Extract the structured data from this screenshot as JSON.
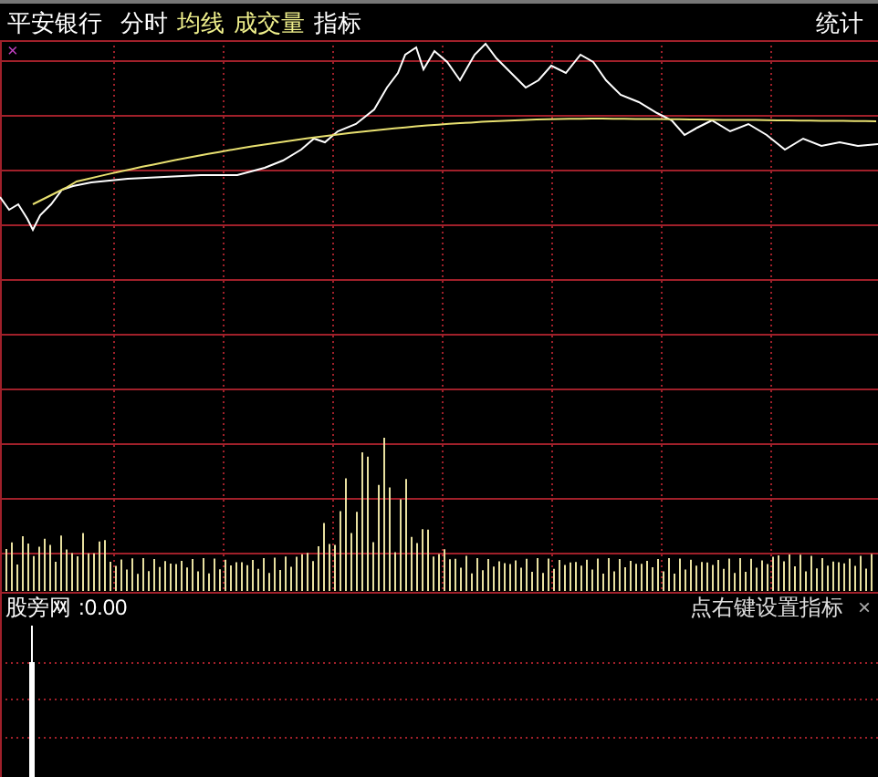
{
  "header": {
    "stock_name": "平安银行",
    "tabs": [
      {
        "label": "分时",
        "color": "#ffffff"
      },
      {
        "label": "均线",
        "color": "#f0f08c"
      },
      {
        "label": "成交量",
        "color": "#f0f08c"
      },
      {
        "label": "指标",
        "color": "#ffffff"
      }
    ],
    "stats_button": "统计"
  },
  "main_chart": {
    "close_mark": "×"
  },
  "indicator_panel": {
    "name": "股旁网",
    "value": ":0.00",
    "hint": "点右键设置指标",
    "close_mark": "×"
  }
}
